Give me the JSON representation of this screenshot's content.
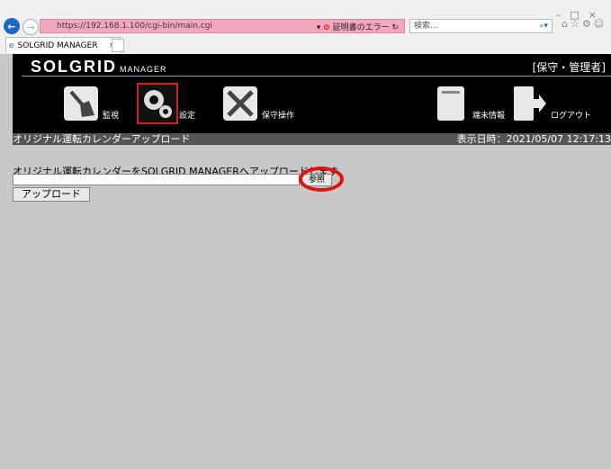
{
  "browser": {
    "url": "https://192.168.1.100/cgi-bin/main.cgi",
    "cert_error": "証明書のエラー",
    "search_placeholder": "検索...",
    "tab_title": "SOLGRID MANAGER"
  },
  "app": {
    "logo": "SOLGRID",
    "logo_sub": "MANAGER",
    "role": "[保守・管理者]",
    "nav": [
      {
        "label": "監視",
        "icon": "broom-icon"
      },
      {
        "label": "設定",
        "icon": "gears-icon"
      },
      {
        "label": "保守操作",
        "icon": "tools-icon"
      },
      {
        "label": "端末情報",
        "icon": "device-icon"
      },
      {
        "label": "ログアウト",
        "icon": "logout-icon"
      }
    ],
    "page_title": "オリジナル運転カレンダーアップロード",
    "datetime": "表示日時：2021/05/07 12:17:13"
  },
  "form": {
    "description": "オリジナル運転カレンダーをSOLGRID MANAGERへアップロードします。",
    "browse_label": "参照",
    "upload_label": "アップロード"
  },
  "colors": {
    "accent_mark": "#e31010",
    "address_error": "#f4a6bd"
  }
}
